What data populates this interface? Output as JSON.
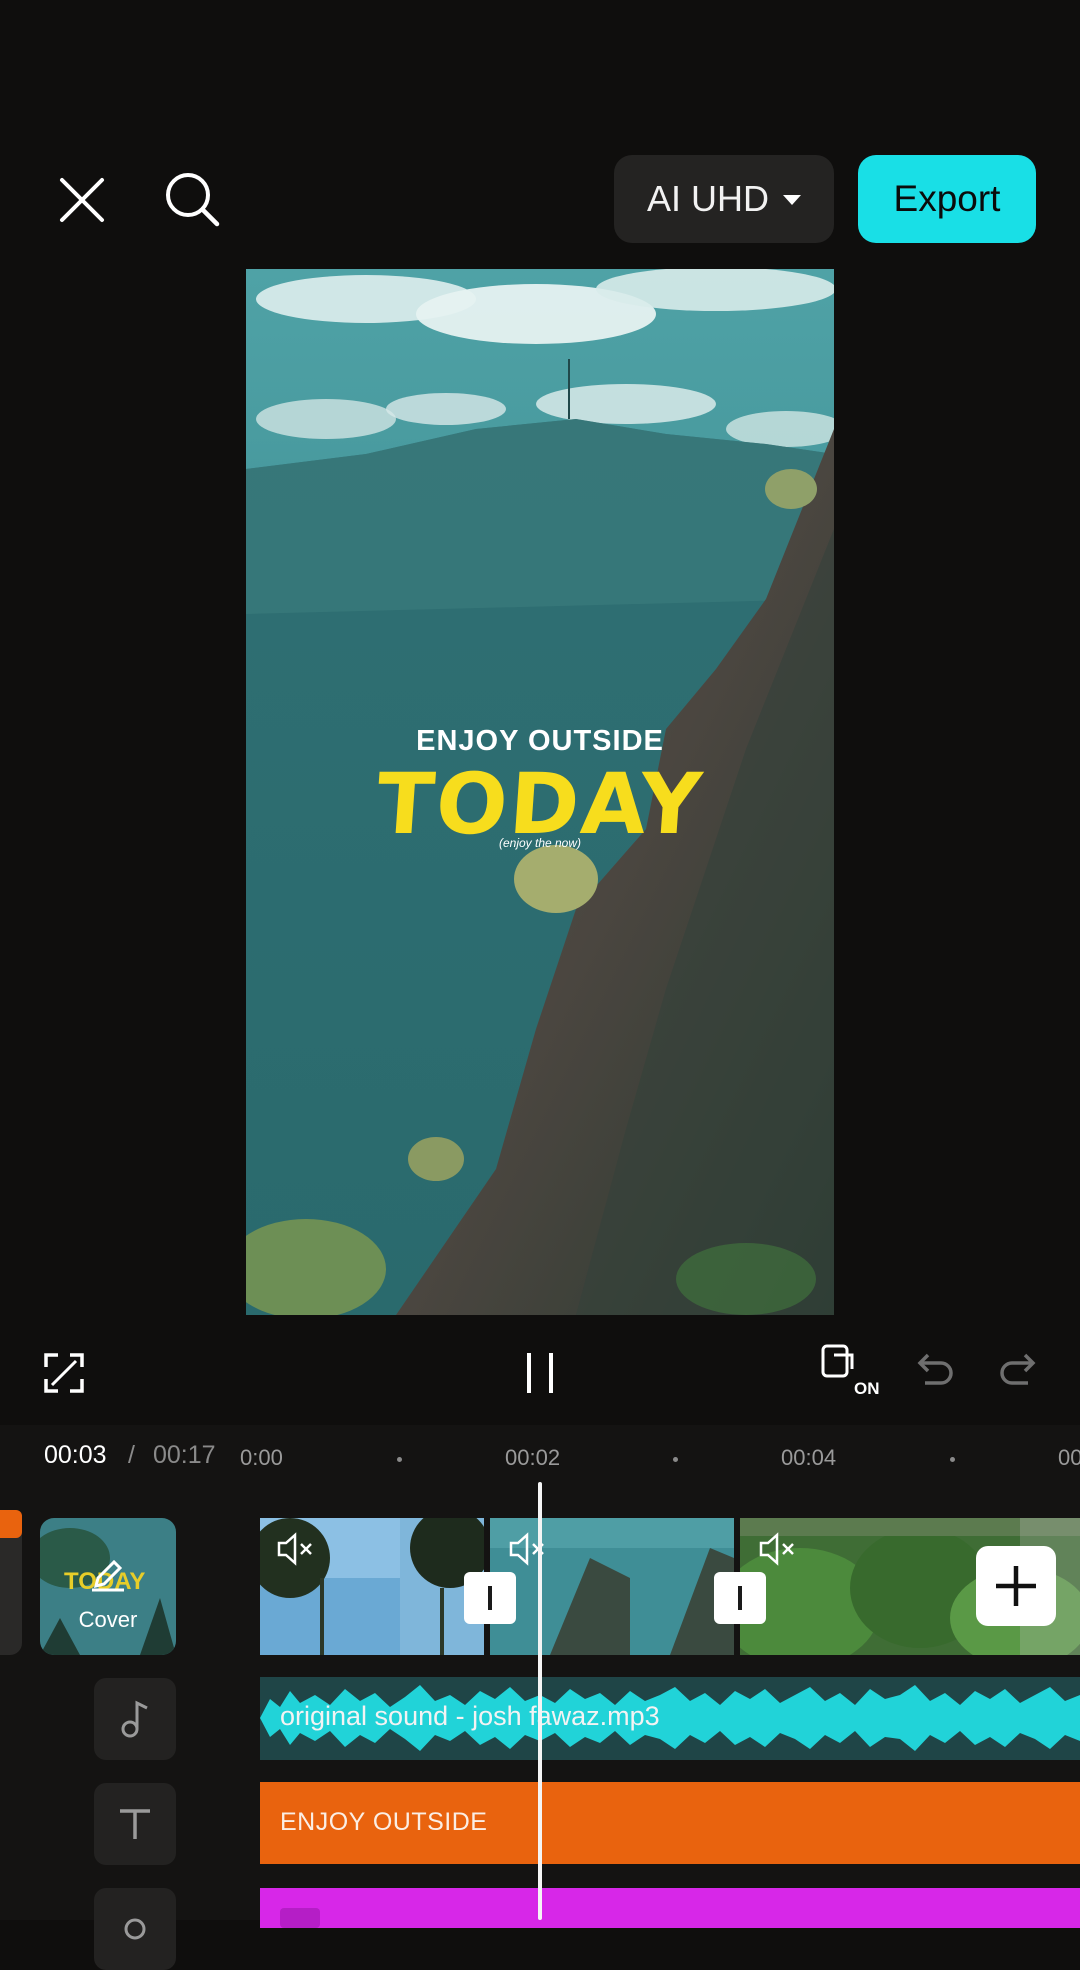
{
  "topbar": {
    "close_icon": "close-icon",
    "search_icon": "search-icon",
    "quality_label": "AI UHD",
    "export_label": "Export"
  },
  "preview": {
    "line1": "ENJOY OUTSIDE",
    "line2": "TODAY",
    "line3": "(enjoy the now)"
  },
  "controls": {
    "fullscreen_icon": "fullscreen-icon",
    "pause_icon": "pause-icon",
    "keyframe_label": "ON",
    "undo_icon": "undo-icon",
    "redo_icon": "redo-icon"
  },
  "timeline": {
    "current": "00:03",
    "separator": "/",
    "total": "00:17",
    "ruler": [
      "0:00",
      "00:02",
      "00:04",
      "00"
    ],
    "cover_label": "Cover",
    "cover_thumb_text": "TODAY",
    "audio_label": "original sound - josh fawaz.mp3",
    "text_label": "ENJOY OUTSIDE"
  },
  "colors": {
    "accent": "#19dfe6",
    "text_track": "#e9630e",
    "audio_track": "#1f4547",
    "sticker_track": "#d727e8",
    "title_yellow": "#f7dd1d"
  }
}
